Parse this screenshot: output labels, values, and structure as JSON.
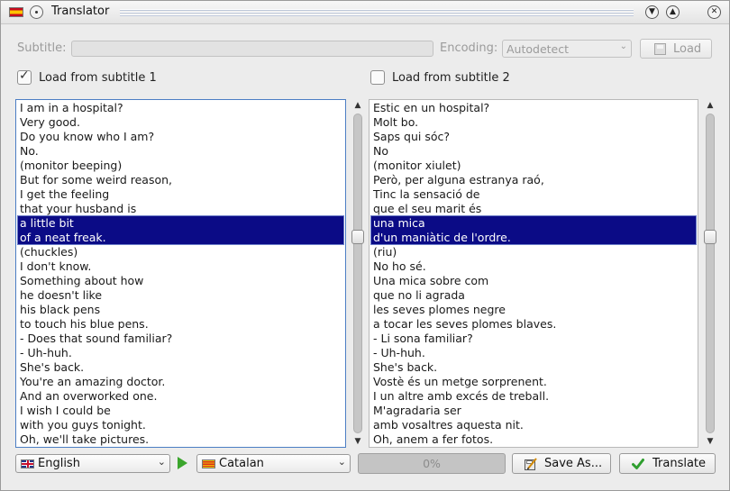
{
  "window": {
    "title": "Translator",
    "controls": [
      "collapse",
      "restore",
      "close"
    ]
  },
  "subtitle_row": {
    "subtitle_label": "Subtitle:",
    "subtitle_value": "",
    "encoding_label": "Encoding:",
    "encoding_value": "Autodetect",
    "load_label": "Load",
    "enabled": false
  },
  "options": {
    "load_sub1_label": "Load from subtitle 1",
    "load_sub1_checked": true,
    "load_sub2_label": "Load from subtitle 2",
    "load_sub2_checked": false
  },
  "source_pane": {
    "lines": [
      "I am in a hospital?",
      "Very good.",
      "Do you know who I am?",
      "No.",
      "(monitor beeping)",
      "But for some weird reason,",
      "I get the feeling",
      "that your husband is",
      "a little bit",
      "of a neat freak.",
      "(chuckles)",
      "I don't know.",
      "Something about how",
      "he doesn't like",
      "his black pens",
      "to touch his blue pens.",
      "- Does that sound familiar?",
      "- Uh-huh.",
      "She's back.",
      "You're an amazing doctor.",
      "And an overworked one.",
      "I wish I could be",
      "with you guys tonight.",
      "Oh, we'll take pictures."
    ],
    "selected_lines": [
      8,
      9
    ]
  },
  "target_pane": {
    "lines": [
      "Estic en un hospital?",
      "Molt bo.",
      "Saps qui sóc?",
      "No",
      "(monitor xiulet)",
      "Però, per alguna estranya raó,",
      "Tinc la sensació de",
      "que el seu marit és",
      "una mica",
      "d'un maniàtic de l'ordre.",
      "(riu)",
      "No ho sé.",
      "Una mica sobre com",
      "que no li agrada",
      "les seves plomes negre",
      "a tocar les seves plomes blaves.",
      "- Li sona familiar?",
      "- Uh-huh.",
      "She's back.",
      "Vostè és un metge sorprenent.",
      "I un altre amb excés de treball.",
      "M'agradaria ser",
      "amb vosaltres aquesta nit.",
      "Oh, anem a fer fotos."
    ],
    "selected_lines": [
      8,
      9
    ]
  },
  "bottom_bar": {
    "source_language": "English",
    "target_language": "Catalan",
    "progress_text": "0%",
    "progress_value": 0,
    "save_as_label": "Save As...",
    "translate_label": "Translate"
  },
  "colors": {
    "selection": "#0b0b86",
    "focus_border": "#4c7ec4",
    "play_arrow": "#3aa52c",
    "check_green": "#2e9e2e"
  }
}
